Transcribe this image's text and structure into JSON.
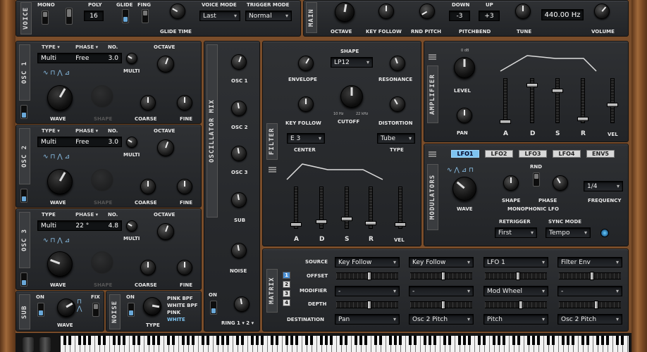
{
  "main_top": {
    "mono": "MONO",
    "poly": "POLY",
    "poly_value": "16",
    "glide": "GLIDE",
    "fing": "FING",
    "glide_time": "GLIDE TIME",
    "voice_mode_label": "VOICE MODE",
    "voice_mode": "Last",
    "trigger_mode_label": "TRIGGER MODE",
    "trigger_mode": "Normal",
    "voice_tab": "VOICE",
    "main_tab": "MAIN",
    "octave": "OCTAVE",
    "key_follow": "KEY FOLLOW",
    "rnd_pitch": "RND PITCH",
    "down": "DOWN",
    "up": "UP",
    "down_value": "-3",
    "up_value": "+3",
    "pitchbend": "PITCHBEND",
    "tune": "TUNE",
    "tune_value": "440.00 Hz",
    "volume": "VOLUME"
  },
  "oscillators": [
    {
      "tab": "OSC 1",
      "type_label": "TYPE",
      "type": "Multi",
      "phase_label": "PHASE",
      "phase": "Free",
      "no_label": "NO.",
      "no": "3.0",
      "det": "DET",
      "multi": "MULTI",
      "octave": "OCTAVE",
      "wave": "WAVE",
      "shape": "SHAPE",
      "coarse": "COARSE",
      "fine": "FINE"
    },
    {
      "tab": "OSC 2",
      "type_label": "TYPE",
      "type": "Multi",
      "phase_label": "PHASE",
      "phase": "Free",
      "no_label": "NO.",
      "no": "3.0",
      "det": "DET",
      "multi": "MULTI",
      "octave": "OCTAVE",
      "wave": "WAVE",
      "shape": "SHAPE",
      "coarse": "COARSE",
      "fine": "FINE"
    },
    {
      "tab": "OSC 3",
      "type_label": "TYPE",
      "type": "Multi",
      "phase_label": "PHASE",
      "phase": "22 °",
      "no_label": "NO.",
      "no": "4.8",
      "det": "DET",
      "multi": "MULTI",
      "octave": "OCTAVE",
      "wave": "WAVE",
      "shape": "SHAPE",
      "coarse": "COARSE",
      "fine": "FINE"
    }
  ],
  "mix": {
    "tab": "OSCILLATOR MIX",
    "osc1": "OSC 1",
    "osc2": "OSC 2",
    "osc3": "OSC 3",
    "sub": "SUB",
    "noise": "NOISE",
    "ring": "RING 1 ▾ 2 ▾",
    "on": "ON"
  },
  "sub": {
    "tab": "SUB",
    "on": "ON",
    "fix": "FIX",
    "wave": "WAVE"
  },
  "noise": {
    "tab": "NOISE",
    "on": "ON",
    "type": "TYPE",
    "types": [
      "PINK BPF",
      "WHITE BPF",
      "PINK",
      "WHITE"
    ]
  },
  "filter": {
    "tab": "FILTER",
    "shape_label": "SHAPE",
    "shape": "LP12",
    "envelope": "ENVELOPE",
    "resonance": "RESONANCE",
    "cutoff": "CUTOFF",
    "cut_lo": "10 Hz",
    "cut_hi": "22 kHz",
    "key_follow": "KEY FOLLOW",
    "distortion": "DISTORTION",
    "center": "E 3",
    "center_label": "CENTER",
    "type": "Tube",
    "type_label": "TYPE",
    "adsr": [
      "A",
      "D",
      "S",
      "R"
    ],
    "vel": "VEL"
  },
  "amplifier": {
    "tab": "AMPLIFIER",
    "level": "LEVEL",
    "pan": "PAN",
    "db0": "0 dB",
    "adsr": [
      "A",
      "D",
      "S",
      "R"
    ],
    "vel": "VEL"
  },
  "modulators": {
    "tab": "MODULATORS",
    "tabs": [
      "LFO1",
      "LFO2",
      "LFO3",
      "LFO4",
      "ENV5"
    ],
    "active": "LFO1",
    "wave": "WAVE",
    "rnd": "RND",
    "shape": "SHAPE",
    "phase": "PHASE",
    "mono_lfo": "MONOPHONIC LFO",
    "frequency": "FREQUENCY",
    "freq_value": "1/4",
    "retrigger_label": "RETRIGGER",
    "retrigger": "First",
    "sync_label": "SYNC MODE",
    "sync": "Tempo"
  },
  "matrix": {
    "tab": "MATRIX",
    "slots": [
      "1",
      "2",
      "3",
      "4"
    ],
    "source": "SOURCE",
    "offset": "OFFSET",
    "modifier": "MODIFIER",
    "depth": "DEPTH",
    "destination": "DESTINATION",
    "columns": [
      {
        "source": "Key Follow",
        "modifier": "-",
        "destination": "Pan"
      },
      {
        "source": "Key Follow",
        "modifier": "-",
        "destination": "Osc 2 Pitch"
      },
      {
        "source": "LFO 1",
        "modifier": "Mod Wheel",
        "destination": "Pitch"
      },
      {
        "source": "Filter Env",
        "modifier": "-",
        "destination": "Osc 2 Pitch"
      }
    ]
  }
}
